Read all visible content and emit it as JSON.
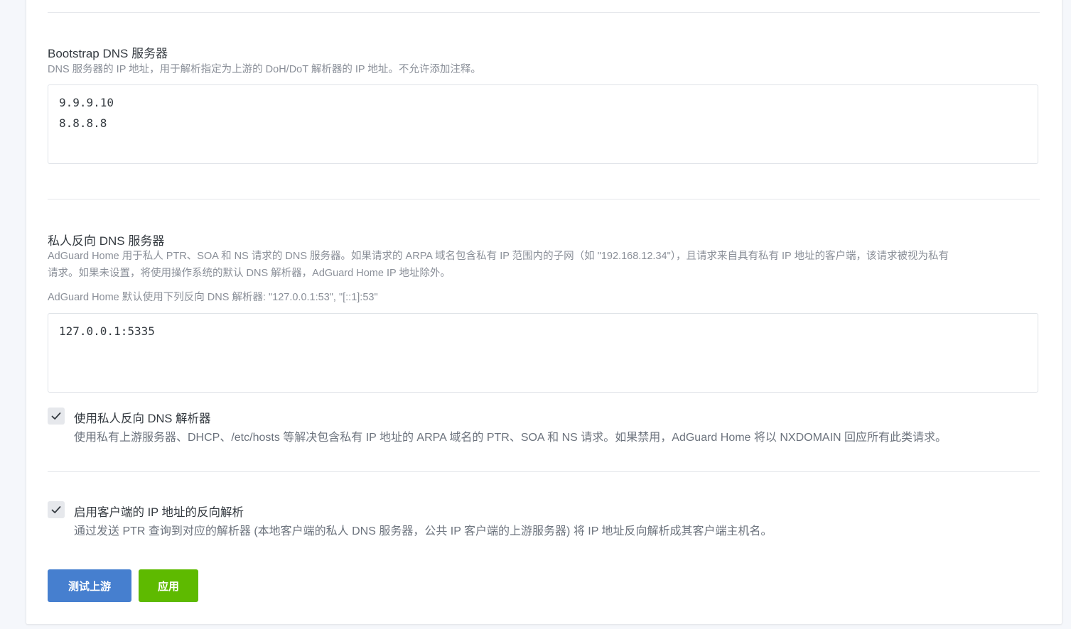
{
  "bootstrap": {
    "title": "Bootstrap DNS 服务器",
    "description": "DNS 服务器的 IP 地址，用于解析指定为上游的 DoH/DoT 解析器的 IP 地址。不允许添加注释。",
    "servers": [
      "9.9.9.10",
      "8.8.8.8"
    ]
  },
  "private_reverse": {
    "title": "私人反向 DNS 服务器",
    "description_line1": "AdGuard Home 用于私人 PTR、SOA 和 NS 请求的 DNS 服务器。如果请求的 ARPA 域名包含私有 IP 范围内的子网（如 \"192.168.12.34\"），且请求来自具有私有 IP 地址的客户端，该请求被视为私有",
    "description_line2": "请求。如果未设置，将使用操作系统的默认 DNS 解析器，AdGuard Home IP 地址除外。",
    "default_note": "AdGuard Home 默认使用下列反向 DNS 解析器: \"127.0.0.1:53\", \"[::1]:53\"",
    "servers": [
      "127.0.0.1:5335"
    ]
  },
  "use_private_resolvers": {
    "label": "使用私人反向 DNS 解析器",
    "description": "使用私有上游服务器、DHCP、/etc/hosts 等解决包含私有 IP 地址的 ARPA 域名的 PTR、SOA 和 NS 请求。如果禁用，AdGuard Home 将以 NXDOMAIN 回应所有此类请求。",
    "checked": true
  },
  "enable_rdns": {
    "label": "启用客户端的 IP 地址的反向解析",
    "description": "通过发送 PTR 查询到对应的解析器 (本地客户端的私人 DNS 服务器，公共 IP 客户端的上游服务器) 将 IP 地址反向解析成其客户端主机名。",
    "checked": true
  },
  "buttons": {
    "test_label": "测试上游",
    "apply_label": "应用"
  },
  "colors": {
    "test_button": "#467fcf",
    "apply_button": "#5eba00"
  },
  "icons": {
    "checkbox_mark": "check-icon"
  }
}
